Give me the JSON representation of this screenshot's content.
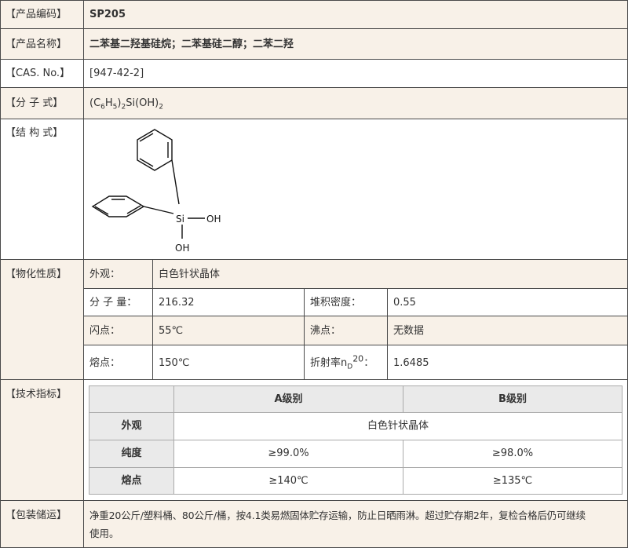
{
  "rows": {
    "code": {
      "label": "【产品编码】",
      "value": "SP205"
    },
    "name": {
      "label": "【产品名称】",
      "value": "二苯基二羟基硅烷；二苯基硅二醇；二苯二羟"
    },
    "cas": {
      "label": "【CAS. No.】",
      "value": "[947-42-2]"
    },
    "formula": {
      "label": "【分 子 式】",
      "parts": [
        "(C",
        "6",
        "H",
        "5",
        ")",
        "2",
        "Si(OH)",
        "2"
      ]
    },
    "structure": {
      "label": "【结 构 式】",
      "atoms": {
        "si": "Si",
        "oh1": "OH",
        "oh2": "OH"
      }
    },
    "properties": {
      "label": "【物化性质】",
      "appearance": {
        "key": "外观：",
        "value": "白色针状晶体"
      },
      "mw": {
        "key": "分 子 量：",
        "value": "216.32"
      },
      "density": {
        "key": "堆积密度：",
        "value": "0.55"
      },
      "flash": {
        "key": "闪点：",
        "value": "55℃"
      },
      "boil": {
        "key": "沸点：",
        "value": "无数据"
      },
      "melt": {
        "key": "熔点：",
        "value": "150℃"
      },
      "refr": {
        "key_main": "折射率n",
        "key_sub": "D",
        "key_sup": "20",
        "key_end": "：",
        "value": "1.6485"
      }
    },
    "specs": {
      "label": "【技术指标】",
      "columns": [
        "A级别",
        "B级别"
      ],
      "rows": [
        {
          "name": "外观",
          "merged": "白色针状晶体"
        },
        {
          "name": "纯度",
          "a": "≥99.0%",
          "b": "≥98.0%"
        },
        {
          "name": "熔点",
          "a": "≥140℃",
          "b": "≥135℃"
        }
      ]
    },
    "packing": {
      "label": "【包装储运】",
      "line1": "净重20公斤/塑料桶、80公斤/桶，按4.1类易燃固体贮存运输，防止日晒雨淋。超过贮存期2年，复检合格后仍可继续",
      "line2": "使用。"
    }
  }
}
